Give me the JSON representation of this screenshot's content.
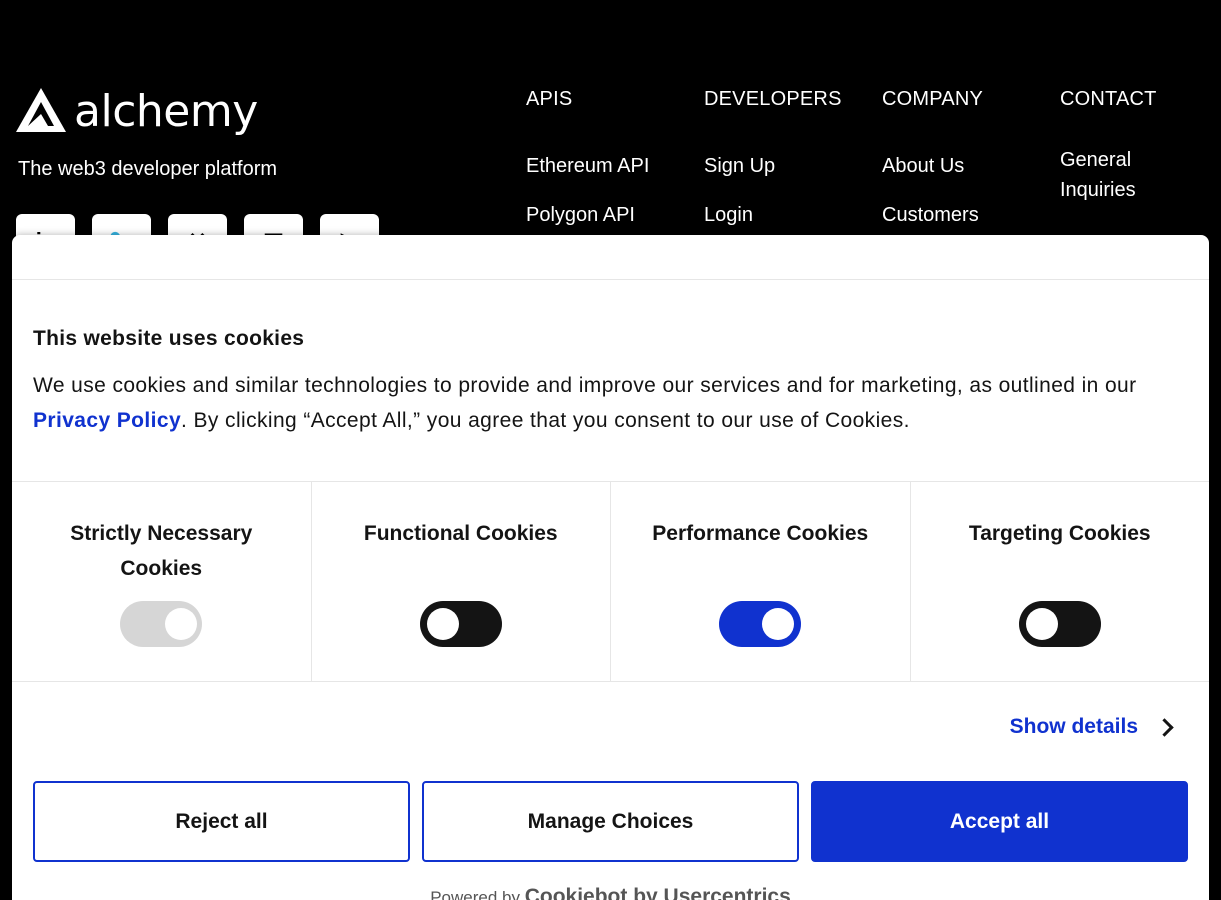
{
  "footer": {
    "logo_text": "alchemy",
    "tagline": "The web3 developer platform",
    "socials": [
      {
        "icon": "linkedin-icon",
        "glyph": "in"
      },
      {
        "icon": "twitter-bird-icon",
        "glyph": "🐦"
      },
      {
        "icon": "x-icon",
        "glyph": "✕"
      },
      {
        "icon": "medium-icon",
        "glyph": "▣"
      },
      {
        "icon": "youtube-icon",
        "glyph": "▶"
      }
    ],
    "columns": [
      {
        "heading": "APIS",
        "links": [
          "Ethereum API",
          "Polygon API"
        ]
      },
      {
        "heading": "DEVELOPERS",
        "links": [
          "Sign Up",
          "Login"
        ]
      },
      {
        "heading": "COMPANY",
        "links": [
          "About Us",
          "Customers"
        ]
      },
      {
        "heading": "CONTACT",
        "links": [
          "General Inquiries"
        ]
      }
    ]
  },
  "cookie_dialog": {
    "title": "This website uses cookies",
    "text_before": "We use cookies and similar technologies to provide and improve our services and for marketing, as outlined in our ",
    "privacy_link": "Privacy Policy",
    "text_after": ". By clicking “Accept All,” you agree that you consent to our use of Cookies.",
    "categories": [
      {
        "label": "Strictly Necessary Cookies",
        "state": "disabled"
      },
      {
        "label": "Functional Cookies",
        "state": "off"
      },
      {
        "label": "Performance Cookies",
        "state": "on"
      },
      {
        "label": "Targeting Cookies",
        "state": "off"
      }
    ],
    "show_details": "Show details",
    "buttons": {
      "reject": "Reject all",
      "manage": "Manage Choices",
      "accept": "Accept all"
    },
    "powered_prefix": "Powered by",
    "powered_brand": "Cookiebot by Usercentrics"
  },
  "colors": {
    "accent": "#1032cf",
    "background": "#000000",
    "dialog": "#ffffff"
  }
}
